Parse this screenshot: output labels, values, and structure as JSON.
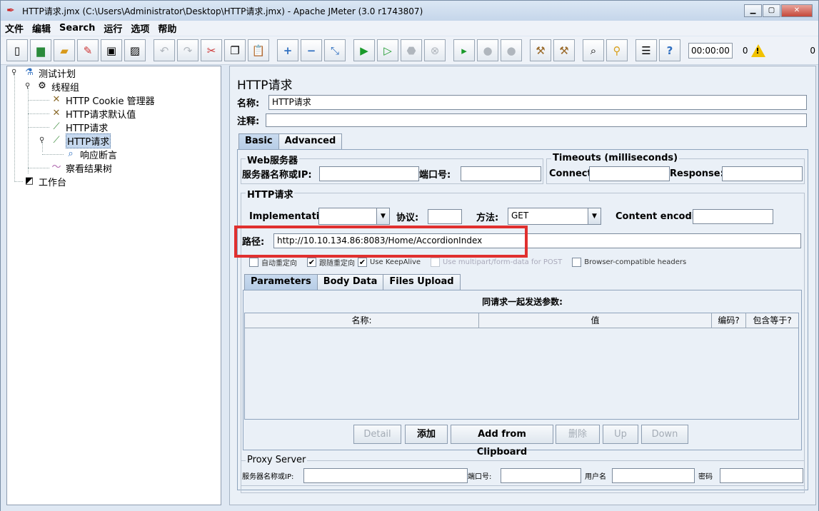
{
  "window": {
    "title": "HTTP请求.jmx (C:\\Users\\Administrator\\Desktop\\HTTP请求.jmx) - Apache JMeter (3.0 r1743807)"
  },
  "menu": [
    "文件",
    "编辑",
    "Search",
    "运行",
    "选项",
    "帮助"
  ],
  "toolbar": {
    "timer": "00:00:00",
    "warnings": "0",
    "active_count": "0",
    "icons": [
      "new-icon",
      "templates-icon",
      "open-icon",
      "close-icon",
      "save-icon",
      "save-as-icon",
      "undo-icon",
      "redo-icon",
      "cut-icon",
      "copy-icon",
      "paste-icon",
      "expand-icon",
      "collapse-icon",
      "toggle-icon",
      "start-icon",
      "start-no-pause-icon",
      "stop-icon",
      "shutdown-icon",
      "remote-start-icon",
      "remote-stop-icon",
      "remote-shutdown-icon",
      "clear-icon",
      "clear-all-icon",
      "search-icon",
      "reset-search-icon",
      "function-helper-icon",
      "help-icon"
    ]
  },
  "tree": {
    "test_plan": "测试计划",
    "thread_group": "线程组",
    "cookie_manager": "HTTP Cookie 管理器",
    "defaults": "HTTP请求默认值",
    "http_request_1": "HTTP请求",
    "http_request_2": "HTTP请求",
    "assertion": "响应断言",
    "result_tree": "察看结果树",
    "workbench": "工作台"
  },
  "panel": {
    "heading": "HTTP请求",
    "name_label": "名称:",
    "name_value": "HTTP请求",
    "comment_label": "注释:",
    "comment_value": "",
    "tabs": [
      "Basic",
      "Advanced"
    ],
    "web_server": {
      "title": "Web服务器",
      "server_label": "服务器名称或IP:",
      "server_value": "",
      "port_label": "端口号:",
      "port_value": ""
    },
    "timeouts": {
      "title": "Timeouts (milliseconds)",
      "connect_label": "Connect:",
      "connect_value": "",
      "response_label": "Response:",
      "response_value": ""
    },
    "http_request": {
      "title": "HTTP请求",
      "impl_label": "Implementation:",
      "impl_value": "",
      "protocol_label": "协议:",
      "protocol_value": "",
      "method_label": "方法:",
      "method_value": "GET",
      "encoding_label": "Content encoding:",
      "encoding_value": "",
      "path_label": "路径:",
      "path_value": "http://10.10.134.86:8083/Home/AccordionIndex"
    },
    "options": [
      {
        "label": "自动重定向",
        "checked": false,
        "disabled": false
      },
      {
        "label": "跟随重定向",
        "checked": true,
        "disabled": false
      },
      {
        "label": "Use KeepAlive",
        "checked": true,
        "disabled": false
      },
      {
        "label": "Use multipart/form-data for POST",
        "checked": false,
        "disabled": true
      },
      {
        "label": "Browser-compatible headers",
        "checked": false,
        "disabled": false
      }
    ],
    "sub_tabs": [
      "Parameters",
      "Body Data",
      "Files Upload"
    ],
    "params_title": "同请求一起发送参数:",
    "columns": [
      "名称:",
      "值",
      "编码?",
      "包含等于?"
    ],
    "buttons": {
      "detail": "Detail",
      "add": "添加",
      "clipboard": "Add from Clipboard",
      "delete": "删除",
      "up": "Up",
      "down": "Down"
    },
    "proxy": {
      "title": "Proxy Server",
      "server_label": "服务器名称或IP:",
      "server_value": "",
      "port_label": "端口号:",
      "port_value": "",
      "user_label": "用户名",
      "user_value": "",
      "password_label": "密码",
      "password_value": ""
    }
  }
}
